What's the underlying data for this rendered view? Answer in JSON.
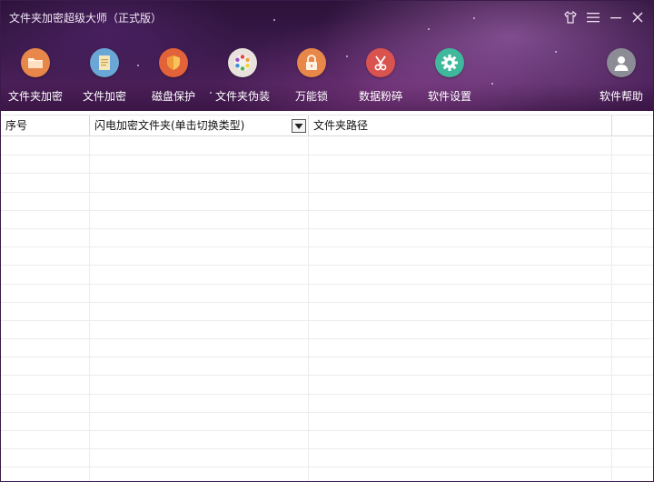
{
  "window": {
    "title": "文件夹加密超级大师（正式版）",
    "controls": [
      {
        "name": "skin-button",
        "icon": "tshirt-icon"
      },
      {
        "name": "menu-button",
        "icon": "hamburger-menu-icon"
      },
      {
        "name": "minimize-button",
        "icon": "minimize-icon"
      },
      {
        "name": "close-button",
        "icon": "close-icon"
      }
    ]
  },
  "toolbar": {
    "items": [
      {
        "label": "文件夹加密",
        "icon": "folder-icon",
        "color": "#e8874a"
      },
      {
        "label": "文件加密",
        "icon": "file-icon",
        "color": "#6aa6d6"
      },
      {
        "label": "磁盘保护",
        "icon": "shield-icon",
        "color": "#e2623a"
      },
      {
        "label": "文件夹伪装",
        "icon": "color-wheel-icon",
        "color": "#e9e2dc"
      },
      {
        "label": "万能锁",
        "icon": "lock-icon",
        "color": "#e8874a"
      },
      {
        "label": "数据粉碎",
        "icon": "scissors-icon",
        "color": "#d9534f"
      },
      {
        "label": "软件设置",
        "icon": "gear-icon",
        "color": "#3fb89c"
      },
      {
        "label": "软件帮助",
        "icon": "user-icon",
        "color": "#8c8c96"
      }
    ]
  },
  "table": {
    "columns": [
      "序号",
      "闪电加密文件夹(单击切换类型)",
      "文件夹路径",
      ""
    ],
    "dropdown_icon": "triangle-down-icon",
    "rows": []
  }
}
